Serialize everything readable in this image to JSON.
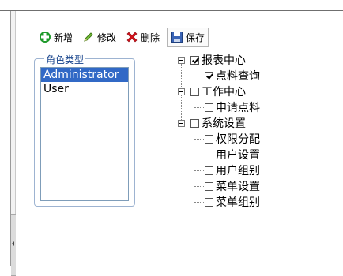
{
  "toolbar": {
    "buttons": [
      {
        "label": "新增",
        "icon": "add-icon",
        "color": "#1f9a2b"
      },
      {
        "label": "修改",
        "icon": "edit-icon",
        "color": "#4a8f1f"
      },
      {
        "label": "删除",
        "icon": "delete-icon",
        "color": "#d0121b"
      },
      {
        "label": "保存",
        "icon": "save-icon",
        "color": "#2a4f9a"
      }
    ]
  },
  "role_panel": {
    "legend": "角色类型",
    "items": [
      {
        "label": "Administrator",
        "selected": true
      },
      {
        "label": "User",
        "selected": false
      }
    ]
  },
  "tree": {
    "nodes": [
      {
        "label": "报表中心",
        "checked": true,
        "children": [
          {
            "label": "点料查询",
            "checked": true
          }
        ]
      },
      {
        "label": "工作中心",
        "checked": false,
        "children": [
          {
            "label": "申请点料",
            "checked": false
          }
        ]
      },
      {
        "label": "系统设置",
        "checked": false,
        "children": [
          {
            "label": "权限分配",
            "checked": false
          },
          {
            "label": "用户设置",
            "checked": false
          },
          {
            "label": "用户组别",
            "checked": false
          },
          {
            "label": "菜单设置",
            "checked": false
          },
          {
            "label": "菜单组别",
            "checked": false
          }
        ]
      }
    ]
  }
}
